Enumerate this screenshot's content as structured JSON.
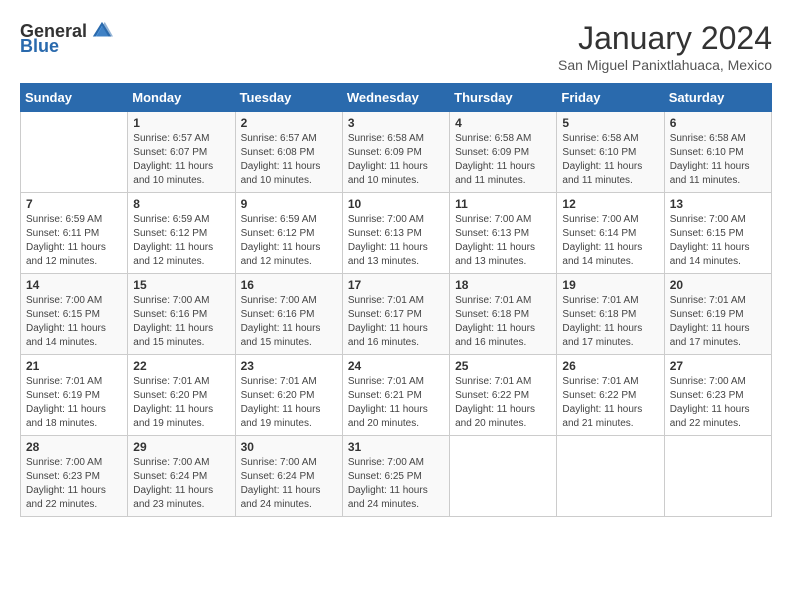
{
  "logo": {
    "general": "General",
    "blue": "Blue"
  },
  "title": "January 2024",
  "subtitle": "San Miguel Panixtlahuaca, Mexico",
  "days_of_week": [
    "Sunday",
    "Monday",
    "Tuesday",
    "Wednesday",
    "Thursday",
    "Friday",
    "Saturday"
  ],
  "weeks": [
    [
      {
        "day": "",
        "info": ""
      },
      {
        "day": "1",
        "info": "Sunrise: 6:57 AM\nSunset: 6:07 PM\nDaylight: 11 hours\nand 10 minutes."
      },
      {
        "day": "2",
        "info": "Sunrise: 6:57 AM\nSunset: 6:08 PM\nDaylight: 11 hours\nand 10 minutes."
      },
      {
        "day": "3",
        "info": "Sunrise: 6:58 AM\nSunset: 6:09 PM\nDaylight: 11 hours\nand 10 minutes."
      },
      {
        "day": "4",
        "info": "Sunrise: 6:58 AM\nSunset: 6:09 PM\nDaylight: 11 hours\nand 11 minutes."
      },
      {
        "day": "5",
        "info": "Sunrise: 6:58 AM\nSunset: 6:10 PM\nDaylight: 11 hours\nand 11 minutes."
      },
      {
        "day": "6",
        "info": "Sunrise: 6:58 AM\nSunset: 6:10 PM\nDaylight: 11 hours\nand 11 minutes."
      }
    ],
    [
      {
        "day": "7",
        "info": "Sunrise: 6:59 AM\nSunset: 6:11 PM\nDaylight: 11 hours\nand 12 minutes."
      },
      {
        "day": "8",
        "info": "Sunrise: 6:59 AM\nSunset: 6:12 PM\nDaylight: 11 hours\nand 12 minutes."
      },
      {
        "day": "9",
        "info": "Sunrise: 6:59 AM\nSunset: 6:12 PM\nDaylight: 11 hours\nand 12 minutes."
      },
      {
        "day": "10",
        "info": "Sunrise: 7:00 AM\nSunset: 6:13 PM\nDaylight: 11 hours\nand 13 minutes."
      },
      {
        "day": "11",
        "info": "Sunrise: 7:00 AM\nSunset: 6:13 PM\nDaylight: 11 hours\nand 13 minutes."
      },
      {
        "day": "12",
        "info": "Sunrise: 7:00 AM\nSunset: 6:14 PM\nDaylight: 11 hours\nand 14 minutes."
      },
      {
        "day": "13",
        "info": "Sunrise: 7:00 AM\nSunset: 6:15 PM\nDaylight: 11 hours\nand 14 minutes."
      }
    ],
    [
      {
        "day": "14",
        "info": "Sunrise: 7:00 AM\nSunset: 6:15 PM\nDaylight: 11 hours\nand 14 minutes."
      },
      {
        "day": "15",
        "info": "Sunrise: 7:00 AM\nSunset: 6:16 PM\nDaylight: 11 hours\nand 15 minutes."
      },
      {
        "day": "16",
        "info": "Sunrise: 7:00 AM\nSunset: 6:16 PM\nDaylight: 11 hours\nand 15 minutes."
      },
      {
        "day": "17",
        "info": "Sunrise: 7:01 AM\nSunset: 6:17 PM\nDaylight: 11 hours\nand 16 minutes."
      },
      {
        "day": "18",
        "info": "Sunrise: 7:01 AM\nSunset: 6:18 PM\nDaylight: 11 hours\nand 16 minutes."
      },
      {
        "day": "19",
        "info": "Sunrise: 7:01 AM\nSunset: 6:18 PM\nDaylight: 11 hours\nand 17 minutes."
      },
      {
        "day": "20",
        "info": "Sunrise: 7:01 AM\nSunset: 6:19 PM\nDaylight: 11 hours\nand 17 minutes."
      }
    ],
    [
      {
        "day": "21",
        "info": "Sunrise: 7:01 AM\nSunset: 6:19 PM\nDaylight: 11 hours\nand 18 minutes."
      },
      {
        "day": "22",
        "info": "Sunrise: 7:01 AM\nSunset: 6:20 PM\nDaylight: 11 hours\nand 19 minutes."
      },
      {
        "day": "23",
        "info": "Sunrise: 7:01 AM\nSunset: 6:20 PM\nDaylight: 11 hours\nand 19 minutes."
      },
      {
        "day": "24",
        "info": "Sunrise: 7:01 AM\nSunset: 6:21 PM\nDaylight: 11 hours\nand 20 minutes."
      },
      {
        "day": "25",
        "info": "Sunrise: 7:01 AM\nSunset: 6:22 PM\nDaylight: 11 hours\nand 20 minutes."
      },
      {
        "day": "26",
        "info": "Sunrise: 7:01 AM\nSunset: 6:22 PM\nDaylight: 11 hours\nand 21 minutes."
      },
      {
        "day": "27",
        "info": "Sunrise: 7:00 AM\nSunset: 6:23 PM\nDaylight: 11 hours\nand 22 minutes."
      }
    ],
    [
      {
        "day": "28",
        "info": "Sunrise: 7:00 AM\nSunset: 6:23 PM\nDaylight: 11 hours\nand 22 minutes."
      },
      {
        "day": "29",
        "info": "Sunrise: 7:00 AM\nSunset: 6:24 PM\nDaylight: 11 hours\nand 23 minutes."
      },
      {
        "day": "30",
        "info": "Sunrise: 7:00 AM\nSunset: 6:24 PM\nDaylight: 11 hours\nand 24 minutes."
      },
      {
        "day": "31",
        "info": "Sunrise: 7:00 AM\nSunset: 6:25 PM\nDaylight: 11 hours\nand 24 minutes."
      },
      {
        "day": "",
        "info": ""
      },
      {
        "day": "",
        "info": ""
      },
      {
        "day": "",
        "info": ""
      }
    ]
  ]
}
